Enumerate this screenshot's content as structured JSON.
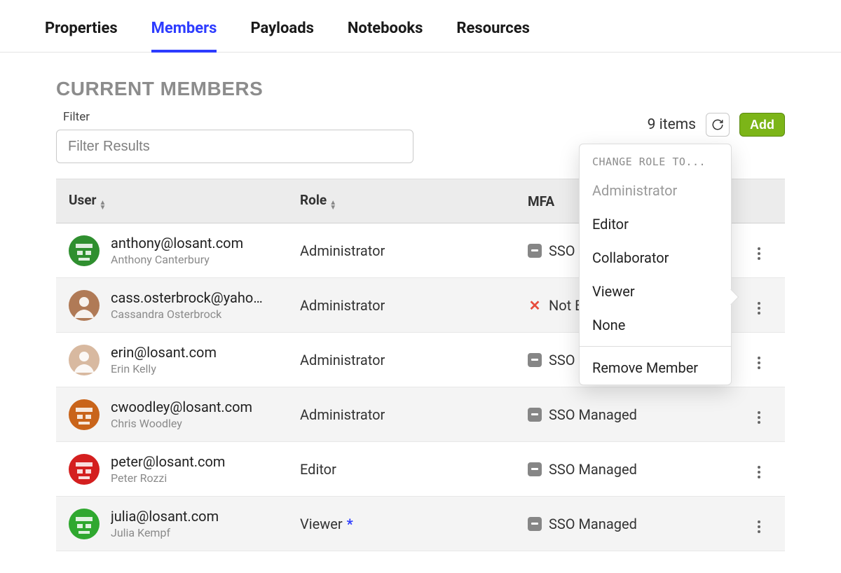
{
  "tabs": [
    {
      "label": "Properties",
      "active": false
    },
    {
      "label": "Members",
      "active": true
    },
    {
      "label": "Payloads",
      "active": false
    },
    {
      "label": "Notebooks",
      "active": false
    },
    {
      "label": "Resources",
      "active": false
    }
  ],
  "section_title": "CURRENT MEMBERS",
  "filter": {
    "label": "Filter",
    "placeholder": "Filter Results",
    "value": ""
  },
  "toolbar": {
    "count_label": "9 items",
    "add_label": "Add"
  },
  "columns": {
    "user": "User",
    "role": "Role",
    "mfa": "MFA"
  },
  "rows": [
    {
      "email": "anthony@losant.com",
      "name": "Anthony Canterbury",
      "role": "Administrator",
      "mfa_status": "SSO Managed",
      "mfa_kind": "sso",
      "avatar": {
        "bg": "#2f8f2f",
        "pixel": true
      }
    },
    {
      "email": "cass.osterbrock@yaho…",
      "name": "Cassandra Osterbrock",
      "role": "Administrator",
      "mfa_status": "Not Enabled",
      "mfa_kind": "not",
      "avatar": {
        "bg": "#b07a56",
        "photo": true
      }
    },
    {
      "email": "erin@losant.com",
      "name": "Erin Kelly",
      "role": "Administrator",
      "mfa_status": "SSO Managed",
      "mfa_kind": "sso",
      "avatar": {
        "bg": "#d8b9a0",
        "photo": true
      }
    },
    {
      "email": "cwoodley@losant.com",
      "name": "Chris Woodley",
      "role": "Administrator",
      "mfa_status": "SSO Managed",
      "mfa_kind": "sso",
      "avatar": {
        "bg": "#c9641a",
        "pixel": true
      }
    },
    {
      "email": "peter@losant.com",
      "name": "Peter Rozzi",
      "role": "Editor",
      "mfa_status": "SSO Managed",
      "mfa_kind": "sso",
      "avatar": {
        "bg": "#d41f1f",
        "pixel": true
      }
    },
    {
      "email": "julia@losant.com",
      "name": "Julia Kempf",
      "role": "Viewer",
      "role_suffix": "*",
      "mfa_status": "SSO Managed",
      "mfa_kind": "sso",
      "avatar": {
        "bg": "#2fa82f",
        "pixel": true
      }
    }
  ],
  "dropdown": {
    "header": "CHANGE ROLE TO...",
    "current": "Administrator",
    "options": [
      "Editor",
      "Collaborator",
      "Viewer",
      "None"
    ],
    "remove": "Remove Member"
  }
}
